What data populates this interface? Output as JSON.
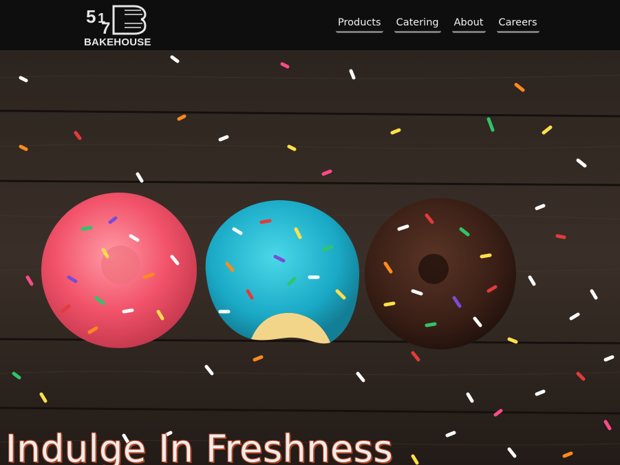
{
  "brand": {
    "logo_number": "517",
    "logo_text": "BAKEHOUSE"
  },
  "nav": {
    "items": [
      {
        "label": "Products"
      },
      {
        "label": "Catering"
      },
      {
        "label": "About"
      },
      {
        "label": "Careers"
      }
    ]
  },
  "hero": {
    "headline": "Indulge In Freshness",
    "image": "three sprinkled donuts (pink, blue, chocolate) on dark wood boards"
  },
  "colors": {
    "navbar": "#0e0e0e",
    "nav_text": "#f2f2f2",
    "nav_underline": "#7d7d7d",
    "headline_text": "#ececec",
    "headline_outline": "#b8431f",
    "wood": "#2a221d"
  }
}
